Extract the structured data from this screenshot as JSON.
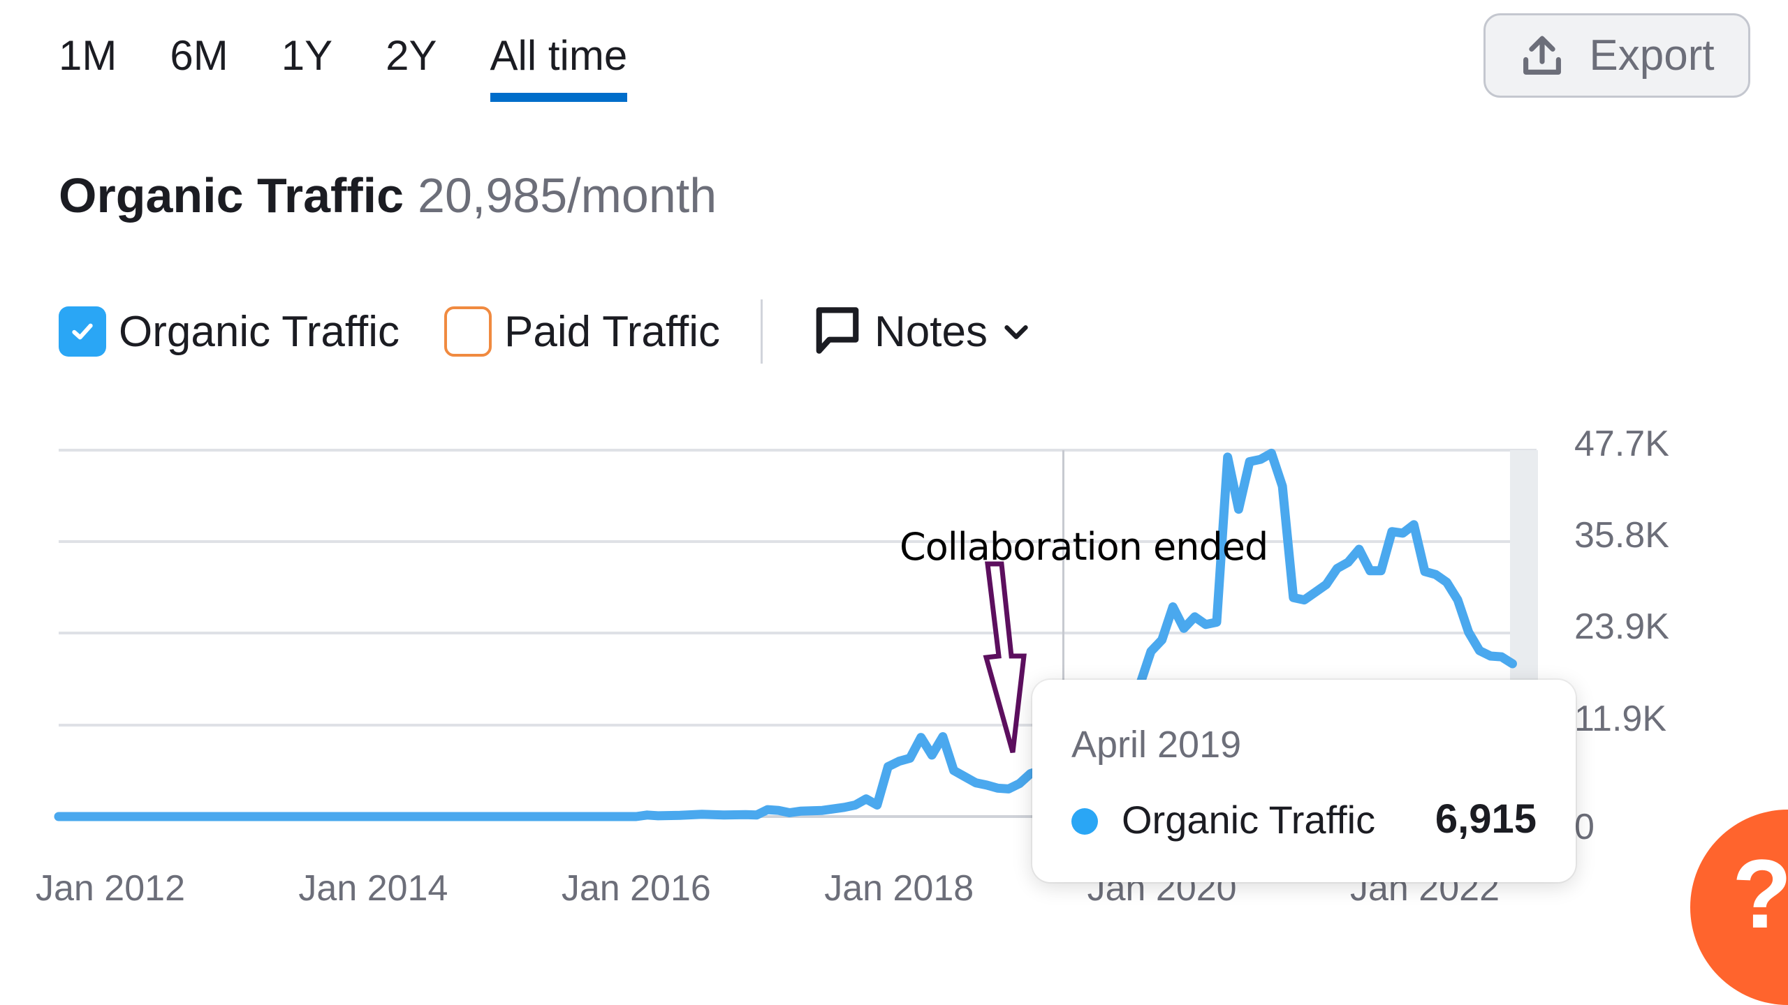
{
  "period_tabs": [
    {
      "label": "1M",
      "active": false
    },
    {
      "label": "6M",
      "active": false
    },
    {
      "label": "1Y",
      "active": false
    },
    {
      "label": "2Y",
      "active": false
    },
    {
      "label": "All time",
      "active": true
    }
  ],
  "export_button": {
    "label": "Export",
    "icon": "upload-icon"
  },
  "header": {
    "title": "Organic Traffic",
    "value": "20,985/month"
  },
  "legend": {
    "items": [
      {
        "label": "Organic Traffic",
        "checked": true,
        "color": "#2aa6f5"
      },
      {
        "label": "Paid Traffic",
        "checked": false,
        "color": "#f08a40"
      }
    ],
    "notes_label": "Notes"
  },
  "annotation": {
    "text": "Collaboration ended",
    "color": "#5c0f5e"
  },
  "tooltip": {
    "date": "April 2019",
    "series": "Organic Traffic",
    "value": "6,915"
  },
  "help_button": {
    "label": "?"
  },
  "colors": {
    "line": "#4aa8ee",
    "grid": "#dfe1e6",
    "accent": "#006dca",
    "help": "#ff642d"
  },
  "chart_data": {
    "type": "line",
    "title": "Organic Traffic",
    "xlabel": "",
    "ylabel": "",
    "y_axis_position": "right",
    "ylim": [
      0,
      47700
    ],
    "yticks": [
      0,
      11900,
      23900,
      35800,
      47700
    ],
    "ytick_labels": [
      "0",
      "11.9K",
      "23.9K",
      "35.8K",
      "47.7K"
    ],
    "xticks": [
      "Jan 2012",
      "Jan 2014",
      "Jan 2016",
      "Jan 2018",
      "Jan 2020",
      "Jan 2022"
    ],
    "grid": true,
    "legend": "top-left",
    "highlight": {
      "x": "2019-04",
      "value": 6915
    },
    "series": [
      {
        "name": "Organic Traffic",
        "points": [
          [
            "2011-09",
            0
          ],
          [
            "2012-06",
            0
          ],
          [
            "2013-06",
            0
          ],
          [
            "2014-06",
            0
          ],
          [
            "2015-06",
            0
          ],
          [
            "2016-01",
            0
          ],
          [
            "2016-02",
            200
          ],
          [
            "2016-03",
            100
          ],
          [
            "2016-05",
            150
          ],
          [
            "2016-07",
            300
          ],
          [
            "2016-09",
            200
          ],
          [
            "2016-11",
            250
          ],
          [
            "2016-12",
            200
          ],
          [
            "2017-01",
            900
          ],
          [
            "2017-02",
            800
          ],
          [
            "2017-03",
            500
          ],
          [
            "2017-04",
            700
          ],
          [
            "2017-06",
            800
          ],
          [
            "2017-08",
            1200
          ],
          [
            "2017-09",
            1500
          ],
          [
            "2017-10",
            2300
          ],
          [
            "2017-11",
            1500
          ],
          [
            "2017-12",
            6500
          ],
          [
            "2018-01",
            7200
          ],
          [
            "2018-02",
            7600
          ],
          [
            "2018-03",
            10300
          ],
          [
            "2018-04",
            8000
          ],
          [
            "2018-05",
            10400
          ],
          [
            "2018-06",
            6000
          ],
          [
            "2018-07",
            5200
          ],
          [
            "2018-08",
            4400
          ],
          [
            "2018-09",
            4100
          ],
          [
            "2018-10",
            3700
          ],
          [
            "2018-11",
            3600
          ],
          [
            "2018-12",
            4300
          ],
          [
            "2019-01",
            5600
          ],
          [
            "2019-04",
            6915
          ],
          [
            "2019-05",
            3500
          ],
          [
            "2019-06",
            3200
          ],
          [
            "2019-07",
            3500
          ],
          [
            "2019-09",
            16800
          ],
          [
            "2019-10",
            16800
          ],
          [
            "2019-11",
            17200
          ],
          [
            "2019-12",
            21500
          ],
          [
            "2020-01",
            23000
          ],
          [
            "2020-02",
            27300
          ],
          [
            "2020-03",
            24500
          ],
          [
            "2020-04",
            26000
          ],
          [
            "2020-05",
            25000
          ],
          [
            "2020-06",
            25300
          ],
          [
            "2020-07",
            46800
          ],
          [
            "2020-08",
            40000
          ],
          [
            "2020-09",
            46200
          ],
          [
            "2020-10",
            46500
          ],
          [
            "2020-11",
            47300
          ],
          [
            "2020-12",
            43000
          ],
          [
            "2021-01",
            28500
          ],
          [
            "2021-02",
            28200
          ],
          [
            "2021-03",
            29200
          ],
          [
            "2021-04",
            30200
          ],
          [
            "2021-05",
            32300
          ],
          [
            "2021-06",
            33100
          ],
          [
            "2021-07",
            34800
          ],
          [
            "2021-08",
            32000
          ],
          [
            "2021-09",
            32000
          ],
          [
            "2021-10",
            37100
          ],
          [
            "2021-11",
            36900
          ],
          [
            "2021-12",
            38000
          ],
          [
            "2022-01",
            31900
          ],
          [
            "2022-02",
            31500
          ],
          [
            "2022-03",
            30500
          ],
          [
            "2022-04",
            28200
          ],
          [
            "2022-05",
            24000
          ],
          [
            "2022-06",
            21600
          ],
          [
            "2022-07",
            20900
          ],
          [
            "2022-08",
            20800
          ],
          [
            "2022-09",
            19900
          ]
        ]
      }
    ]
  }
}
